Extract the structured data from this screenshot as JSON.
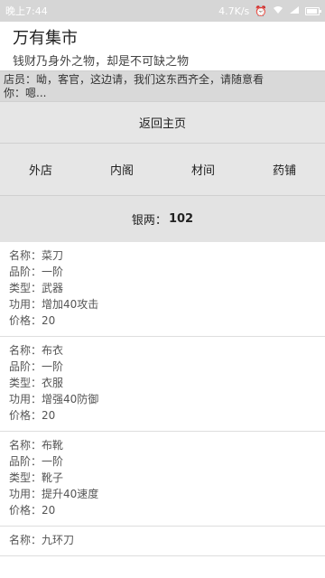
{
  "status": {
    "time": "晚上7:44",
    "speed": "4.7K/s"
  },
  "app": {
    "title": "万有集市",
    "subtitle": "钱财乃身外之物，却是不可缺之物"
  },
  "dialogue": {
    "line1": "店员：呦，客官，这边请，我们这东西齐全，请随意看",
    "line2": "你：嗯..."
  },
  "home_button": "返回主页",
  "tabs": [
    "外店",
    "内阁",
    "材间",
    "药铺"
  ],
  "money": {
    "label": "银两：",
    "value": "102"
  },
  "labels": {
    "name": "名称：",
    "grade": "品阶：",
    "type": "类型：",
    "effect": "功用：",
    "price": "价格："
  },
  "items": [
    {
      "name": "菜刀",
      "grade": "一阶",
      "type": "武器",
      "effect": "增加40攻击",
      "price": "20"
    },
    {
      "name": "布衣",
      "grade": "一阶",
      "type": "衣服",
      "effect": "增强40防御",
      "price": "20"
    },
    {
      "name": "布靴",
      "grade": "一阶",
      "type": "靴子",
      "effect": "提升40速度",
      "price": "20"
    },
    {
      "name": "九环刀"
    }
  ],
  "icons": [
    "alarm-icon",
    "wifi-icon",
    "signal-icon",
    "battery-icon"
  ]
}
